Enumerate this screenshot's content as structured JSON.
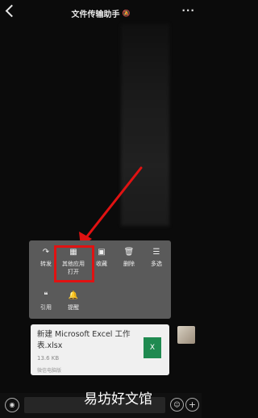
{
  "header": {
    "title": "文件传输助手",
    "mute_icon": "bell-off-icon",
    "more_label": "···"
  },
  "menu": {
    "row1": [
      {
        "label": "转发",
        "icon": "share-icon",
        "glyph": "↷"
      },
      {
        "label": "其他应用打开",
        "icon": "apps-icon",
        "glyph": "▦"
      },
      {
        "label": "收藏",
        "icon": "box-icon",
        "glyph": "▣"
      },
      {
        "label": "删除",
        "icon": "trash-icon",
        "glyph": "🗑"
      },
      {
        "label": "多选",
        "icon": "list-icon",
        "glyph": "☰"
      }
    ],
    "row2": [
      {
        "label": "引用",
        "icon": "quote-icon",
        "glyph": "❝"
      },
      {
        "label": "提醒",
        "icon": "bell-icon",
        "glyph": "🔔"
      }
    ]
  },
  "file": {
    "name": "新建 Microsoft Excel 工作表.xlsx",
    "size": "13.6 KB",
    "source": "微信电脑版",
    "type_glyph": "X"
  },
  "input": {
    "voice_glyph": "◉",
    "emoji_glyph": "☺",
    "plus_glyph": "+"
  },
  "watermark": "易坊好文馆",
  "colors": {
    "highlight": "#e01212",
    "excel": "#1f8a50",
    "menu_bg": "#5a5a5a"
  }
}
